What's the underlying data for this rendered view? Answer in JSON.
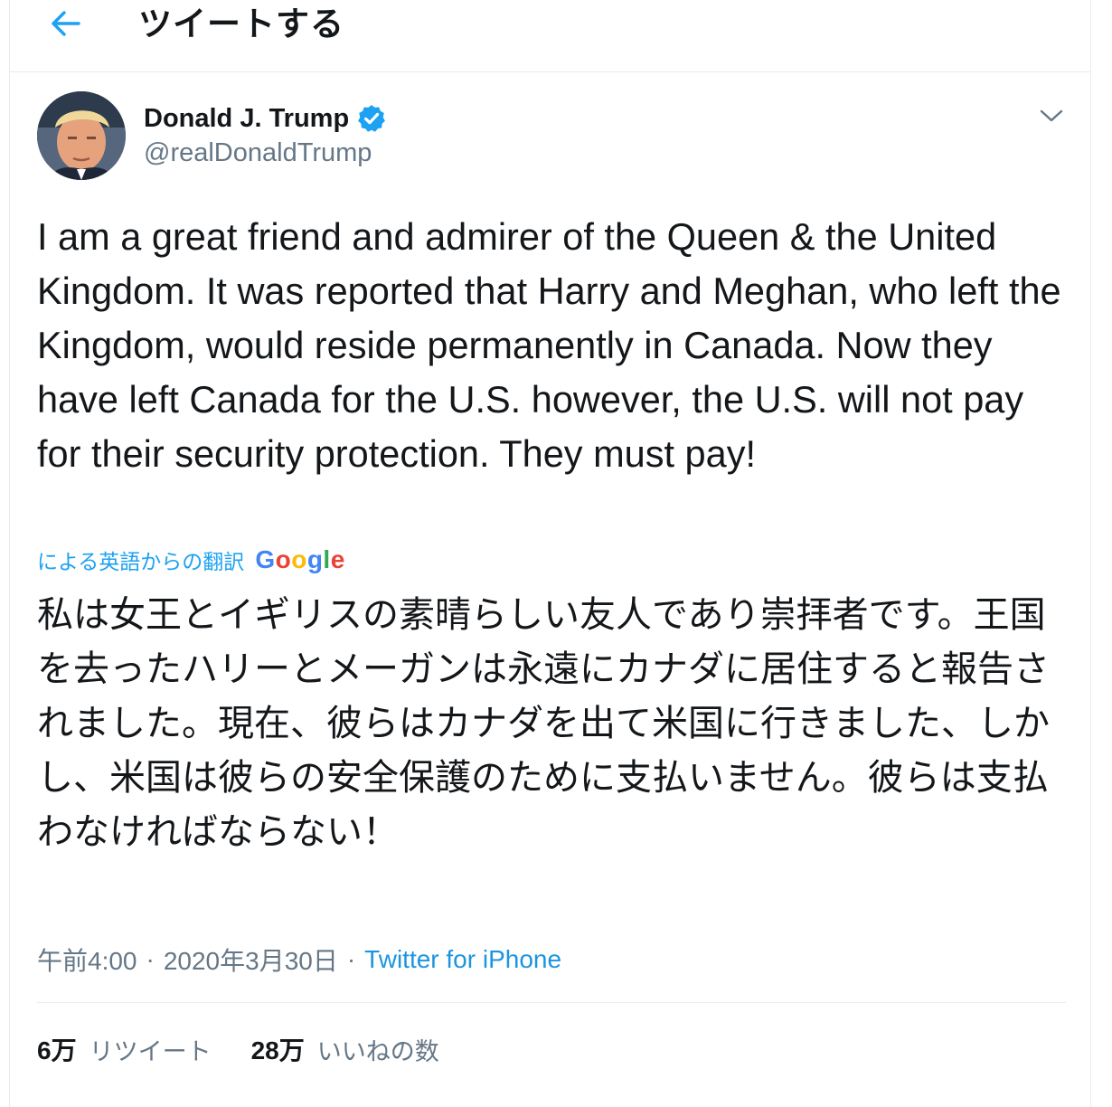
{
  "header": {
    "title": "ツイートする",
    "back_icon": "arrow-left-icon",
    "accent_color": "#1da1f2"
  },
  "tweet": {
    "author_name": "Donald J. Trump",
    "author_handle": "@realDonaldTrump",
    "verified": true,
    "text": "I am a great friend and admirer of the Queen & the United Kingdom. It was reported that Harry and Meghan, who left the Kingdom, would reside permanently in Canada. Now they have left Canada for the U.S. however, the U.S. will not pay for their security protection. They must pay!",
    "translation_label": "による英語からの翻訳",
    "translation_provider": "Google",
    "translated_text": "私は女王とイギリスの素晴らしい友人であり崇拝者です。王国を去ったハリーとメーガンは永遠にカナダに居住すると報告されました。現在、彼らはカナダを出て米国に行きました、しかし、米国は彼らの安全保護のために支払いません。彼らは支払わなければならない！",
    "time": "午前4:00",
    "date": "2020年3月30日",
    "separator": "·",
    "source": "Twitter for iPhone"
  },
  "stats": {
    "retweets_count": "6万",
    "retweets_label": "リツイート",
    "likes_count": "28万",
    "likes_label": "いいねの数"
  }
}
